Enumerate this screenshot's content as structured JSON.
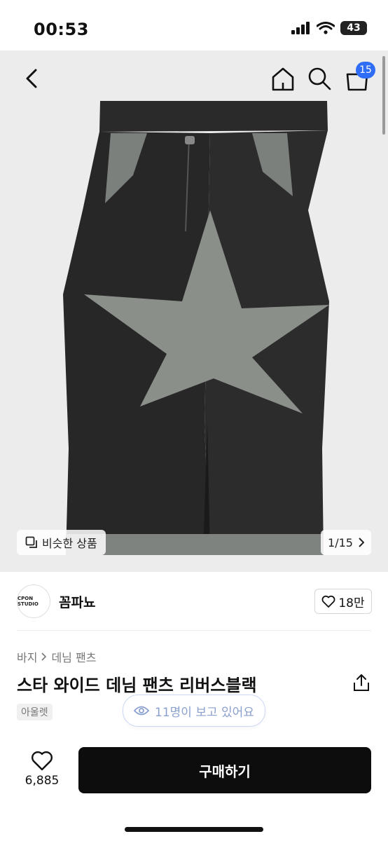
{
  "status_bar": {
    "time": "00:53",
    "battery": "43"
  },
  "nav": {
    "cart_count": "15"
  },
  "gallery": {
    "similar_label": "비슷한 상품",
    "counter": "1/15"
  },
  "shop": {
    "logo_text": "CPON STUDIO",
    "name": "꼼파뇨",
    "likes": "18만"
  },
  "product": {
    "breadcrumb": [
      "바지",
      "데님 팬츠"
    ],
    "title": "스타 와이드 데님 팬츠 리버스블랙",
    "tag": "아울렛",
    "viewers": "11명이 보고 있어요"
  },
  "bottom": {
    "wish_count": "6,885",
    "buy_label": "구매하기"
  },
  "colors": {
    "accent": "#2f6df6",
    "buy_bg": "#0d0d0d",
    "image_bg": "#ececec"
  }
}
